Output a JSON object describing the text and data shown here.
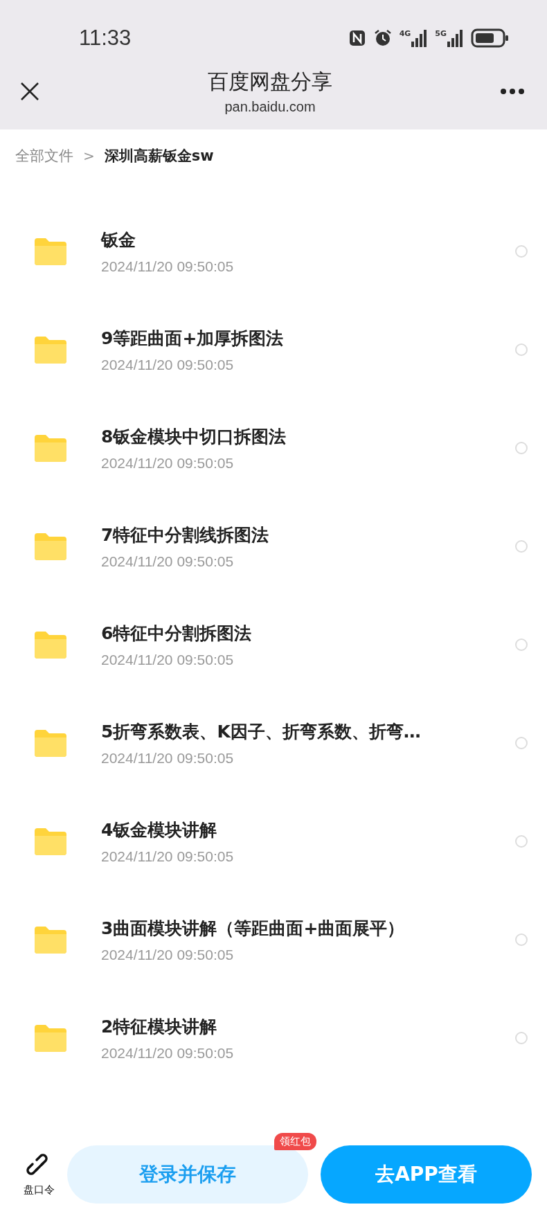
{
  "status_bar": {
    "time": "11:33",
    "network_1": "4G",
    "network_2": "5G"
  },
  "header": {
    "title": "百度网盘分享",
    "subtitle": "pan.baidu.com"
  },
  "breadcrumb": [
    {
      "label": "全部文件",
      "current": false
    },
    {
      "label": "深圳高薪钣金sw",
      "current": true
    }
  ],
  "breadcrumb_separator": ">",
  "files": [
    {
      "name": "钣金",
      "date": "2024/11/20 09:50:05",
      "selected": false
    },
    {
      "name": "9等距曲面+加厚拆图法",
      "date": "2024/11/20 09:50:05",
      "selected": false
    },
    {
      "name": "8钣金模块中切口拆图法",
      "date": "2024/11/20 09:50:05",
      "selected": false
    },
    {
      "name": "7特征中分割线拆图法",
      "date": "2024/11/20 09:50:05",
      "selected": false
    },
    {
      "name": "6特征中分割拆图法",
      "date": "2024/11/20 09:50:05",
      "selected": false
    },
    {
      "name": "5折弯系数表、K因子、折弯系数、折弯…",
      "date": "2024/11/20 09:50:05",
      "selected": false
    },
    {
      "name": "4钣金模块讲解",
      "date": "2024/11/20 09:50:05",
      "selected": false
    },
    {
      "name": "3曲面模块讲解（等距曲面+曲面展平）",
      "date": "2024/11/20 09:50:05",
      "selected": false
    },
    {
      "name": "2特征模块讲解",
      "date": "2024/11/20 09:50:05",
      "selected": false
    }
  ],
  "bottom_bar": {
    "link_label": "盘口令",
    "save_button": "登录并保存",
    "badge": "领红包",
    "app_button": "去APP查看"
  }
}
